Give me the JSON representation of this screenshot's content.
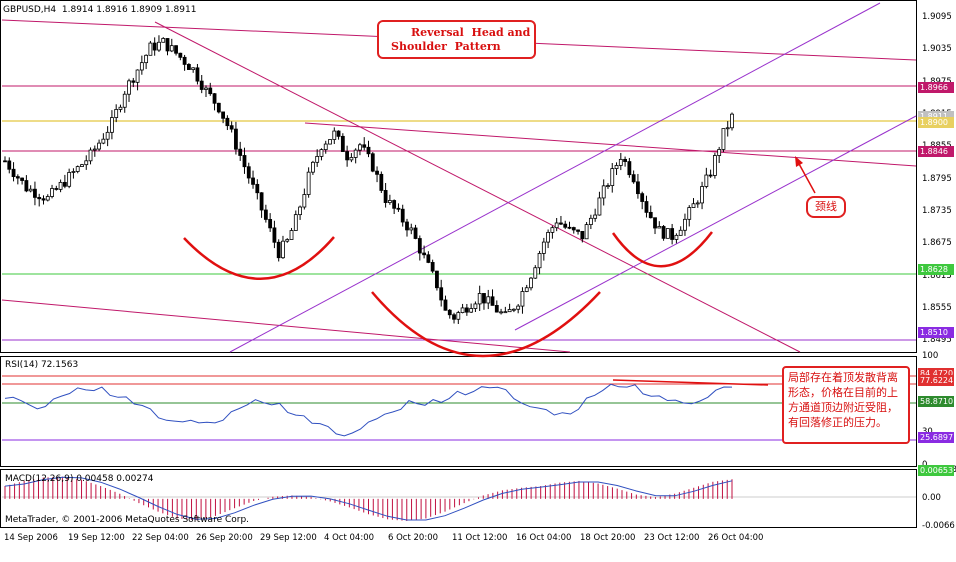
{
  "header": {
    "symbol_info": "GBPUSD,H4  1.8914 1.8916 1.8909 1.8911"
  },
  "annotations": {
    "pattern_title_line1": "Reversal  Head and",
    "pattern_title_line2": "Shoulder  Pattern",
    "neckline_label": "颈线",
    "rsi_note": "局部存在着顶发散背离形态，价格在目前的上方通道顶边附近受阻，有回落修正的压力。"
  },
  "rsi_panel": {
    "label": "RSI(14) 72.1563"
  },
  "macd_panel": {
    "label": "MACD(12,26,9) 0.00458 0.00274"
  },
  "footer": {
    "copyright": "MetaTrader, © 2001-2006 MetaQuotes Software Corp."
  },
  "price_axis": {
    "ticks": [
      "1.9095",
      "1.9035",
      "1.8975",
      "1.8915",
      "1.8855",
      "1.8795",
      "1.8735",
      "1.8675",
      "1.8615",
      "1.8555",
      "1.8495"
    ],
    "tags": [
      {
        "label": "1.8966",
        "color": "#c0186a"
      },
      {
        "label": "1.8911",
        "color": "#c0c0c0"
      },
      {
        "label": "1.8900",
        "color": "#e8d060"
      },
      {
        "label": "1.8846",
        "color": "#c0186a"
      },
      {
        "label": "1.8628",
        "color": "#3ec83e"
      },
      {
        "label": "1.8510",
        "color": "#8a2be2"
      }
    ]
  },
  "rsi_axis": {
    "ticks": [
      "100",
      "30",
      "0"
    ],
    "tags": [
      {
        "label": "84.4720",
        "color": "#e03030"
      },
      {
        "label": "77.6224",
        "color": "#e03030"
      },
      {
        "label": "58.8710",
        "color": "#2e8b2e"
      },
      {
        "label": "25.6897",
        "color": "#8a2be2"
      }
    ]
  },
  "macd_axis": {
    "ticks": [
      "0.00653",
      "0.00",
      "-0.0066"
    ],
    "tags": [
      {
        "label": "0.00653",
        "color": "#3ec83e"
      }
    ]
  },
  "time_axis": [
    "14 Sep 2006",
    "19 Sep 12:00",
    "22 Sep 04:00",
    "26 Sep 20:00",
    "29 Sep 12:00",
    "4 Oct 04:00",
    "6 Oct 20:00",
    "11 Oct 12:00",
    "16 Oct 04:00",
    "18 Oct 20:00",
    "23 Oct 12:00",
    "26 Oct 04:00"
  ],
  "colors": {
    "bull_candle": "#000000",
    "bear_candle": "#000000",
    "trend_red": "#c0186a",
    "channel_violet": "#9932cc",
    "neckline": "#c0186a",
    "resistance_yellow": "#e8d060",
    "support_green": "#3ec83e",
    "arc": "#e01010",
    "rsi_line": "#3050c0",
    "macd_hist": "#c01040",
    "macd_signal": "#3050c0"
  },
  "chart_data": [
    {
      "type": "candlestick",
      "title": "GBPUSD,H4",
      "ylim": [
        1.8475,
        1.9125
      ],
      "close_path": [
        [
          0,
          1.883
        ],
        [
          5,
          1.878
        ],
        [
          10,
          1.876
        ],
        [
          15,
          1.88
        ],
        [
          20,
          1.884
        ],
        [
          25,
          1.89
        ],
        [
          28,
          1.896
        ],
        [
          31,
          1.9
        ],
        [
          34,
          1.904
        ],
        [
          37,
          1.905
        ],
        [
          40,
          1.903
        ],
        [
          44,
          1.9
        ],
        [
          47,
          1.896
        ],
        [
          50,
          1.893
        ],
        [
          53,
          1.888
        ],
        [
          56,
          1.882
        ],
        [
          59,
          1.876
        ],
        [
          62,
          1.87
        ],
        [
          64,
          1.866
        ],
        [
          66,
          1.868
        ],
        [
          68,
          1.872
        ],
        [
          71,
          1.88
        ],
        [
          74,
          1.886
        ],
        [
          77,
          1.888
        ],
        [
          80,
          1.884
        ],
        [
          83,
          1.886
        ],
        [
          86,
          1.882
        ],
        [
          89,
          1.876
        ],
        [
          92,
          1.873
        ],
        [
          95,
          1.87
        ],
        [
          98,
          1.865
        ],
        [
          101,
          1.86
        ],
        [
          103,
          1.855
        ],
        [
          105,
          1.854
        ],
        [
          108,
          1.856
        ],
        [
          111,
          1.858
        ],
        [
          114,
          1.856
        ],
        [
          117,
          1.854
        ],
        [
          120,
          1.857
        ],
        [
          123,
          1.862
        ],
        [
          126,
          1.868
        ],
        [
          129,
          1.872
        ],
        [
          132,
          1.87
        ],
        [
          135,
          1.869
        ],
        [
          138,
          1.874
        ],
        [
          141,
          1.879
        ],
        [
          144,
          1.884
        ],
        [
          147,
          1.88
        ],
        [
          150,
          1.874
        ],
        [
          153,
          1.87
        ],
        [
          156,
          1.869
        ],
        [
          159,
          1.872
        ],
        [
          162,
          1.876
        ],
        [
          165,
          1.881
        ],
        [
          168,
          1.888
        ],
        [
          170,
          1.8911
        ]
      ],
      "horizontal_levels": [
        1.8966,
        1.89,
        1.8846,
        1.8628,
        1.851
      ],
      "annotations": [
        "Reversal  Head and Shoulder  Pattern",
        "颈线"
      ]
    },
    {
      "type": "line",
      "name": "RSI(14)",
      "ylim": [
        0,
        100
      ],
      "levels": [
        84.472,
        77.6224,
        58.871,
        25.6897
      ],
      "values": [
        62,
        58,
        55,
        60,
        66,
        72,
        70,
        64,
        58,
        50,
        44,
        40,
        38,
        42,
        48,
        56,
        60,
        55,
        48,
        40,
        34,
        30,
        33,
        42,
        52,
        58,
        56,
        60,
        66,
        70,
        72,
        68,
        60,
        52,
        46,
        50,
        60,
        70,
        74,
        72,
        66,
        60,
        56,
        62,
        68,
        72
      ]
    },
    {
      "type": "bar",
      "name": "MACD(12,26,9)",
      "ylim": [
        -0.0066,
        0.00653
      ],
      "values": [
        0.003,
        0.0042,
        0.005,
        0.0052,
        0.0045,
        0.003,
        0.0012,
        -0.001,
        -0.003,
        -0.0046,
        -0.005,
        -0.004,
        -0.0022,
        -0.0005,
        0.0005,
        0.0008,
        0.0004,
        -0.0006,
        -0.002,
        -0.0036,
        -0.0048,
        -0.0052,
        -0.0046,
        -0.003,
        -0.001,
        0.0008,
        0.002,
        0.0026,
        0.003,
        0.0038,
        0.0042,
        0.0036,
        0.0024,
        0.001,
        0.0004,
        0.0012,
        0.0026,
        0.004,
        0.0046
      ]
    }
  ]
}
